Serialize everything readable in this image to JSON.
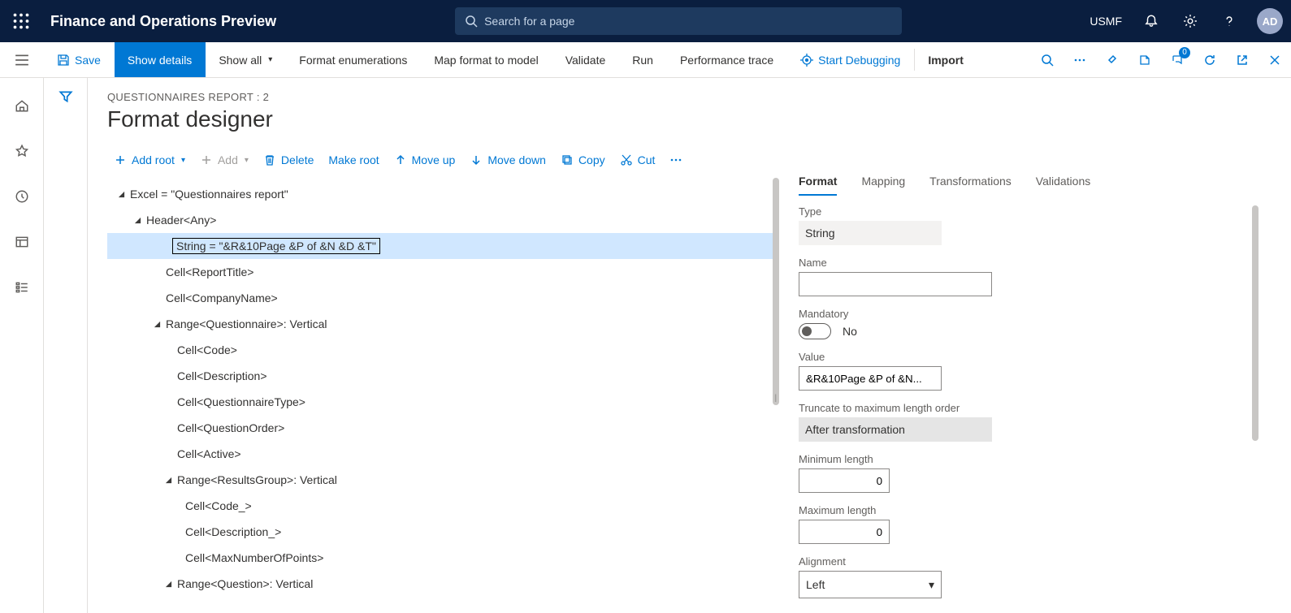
{
  "topbar": {
    "app_title": "Finance and Operations Preview",
    "search_placeholder": "Search for a page",
    "company": "USMF",
    "avatar": "AD"
  },
  "actionbar": {
    "save": "Save",
    "show_details": "Show details",
    "show_all": "Show all",
    "format_enum": "Format enumerations",
    "map_format": "Map format to model",
    "validate": "Validate",
    "run": "Run",
    "perf_trace": "Performance trace",
    "start_debug": "Start Debugging",
    "import": "Import",
    "badge": "0"
  },
  "page": {
    "breadcrumb": "QUESTIONNAIRES REPORT : 2",
    "title": "Format designer"
  },
  "toolbar": {
    "add_root": "Add root",
    "add": "Add",
    "delete": "Delete",
    "make_root": "Make root",
    "move_up": "Move up",
    "move_down": "Move down",
    "copy": "Copy",
    "cut": "Cut"
  },
  "tree": [
    {
      "level": 0,
      "arrow": true,
      "label": "Excel = \"Questionnaires report\""
    },
    {
      "level": 1,
      "arrow": true,
      "label": "Header<Any>"
    },
    {
      "level": 2,
      "arrow": false,
      "selected": true,
      "label": "String = \"&R&10Page &P of &N &D &T\""
    },
    {
      "level": 2,
      "arrow": false,
      "label": "Cell<ReportTitle>",
      "pad": "54px"
    },
    {
      "level": 2,
      "arrow": false,
      "label": "Cell<CompanyName>",
      "pad": "54px"
    },
    {
      "level": 1,
      "arrow": true,
      "label": "Range<Questionnaire>: Vertical",
      "pad": "54px"
    },
    {
      "level": 2,
      "arrow": false,
      "label": "Cell<Code>",
      "pad": "68px"
    },
    {
      "level": 2,
      "arrow": false,
      "label": "Cell<Description>",
      "pad": "68px"
    },
    {
      "level": 2,
      "arrow": false,
      "label": "Cell<QuestionnaireType>",
      "pad": "68px"
    },
    {
      "level": 2,
      "arrow": false,
      "label": "Cell<QuestionOrder>",
      "pad": "68px"
    },
    {
      "level": 2,
      "arrow": false,
      "label": "Cell<Active>",
      "pad": "68px"
    },
    {
      "level": 2,
      "arrow": true,
      "label": "Range<ResultsGroup>: Vertical",
      "pad": "68px",
      "arrowAt": "48px"
    },
    {
      "level": 3,
      "arrow": false,
      "label": "Cell<Code_>",
      "pad": "78px"
    },
    {
      "level": 3,
      "arrow": false,
      "label": "Cell<Description_>",
      "pad": "78px"
    },
    {
      "level": 3,
      "arrow": false,
      "label": "Cell<MaxNumberOfPoints>",
      "pad": "78px"
    },
    {
      "level": 2,
      "arrow": true,
      "label": "Range<Question>: Vertical",
      "pad": "68px",
      "arrowAt": "48px"
    }
  ],
  "tabs": {
    "format": "Format",
    "mapping": "Mapping",
    "transformations": "Transformations",
    "validations": "Validations"
  },
  "form": {
    "type_label": "Type",
    "type_value": "String",
    "name_label": "Name",
    "name_value": "",
    "mandatory_label": "Mandatory",
    "mandatory_value": "No",
    "value_label": "Value",
    "value_value": "&R&10Page &P of &N...",
    "truncate_label": "Truncate to maximum length order",
    "truncate_value": "After transformation",
    "minlen_label": "Minimum length",
    "minlen_value": "0",
    "maxlen_label": "Maximum length",
    "maxlen_value": "0",
    "align_label": "Alignment",
    "align_value": "Left"
  }
}
